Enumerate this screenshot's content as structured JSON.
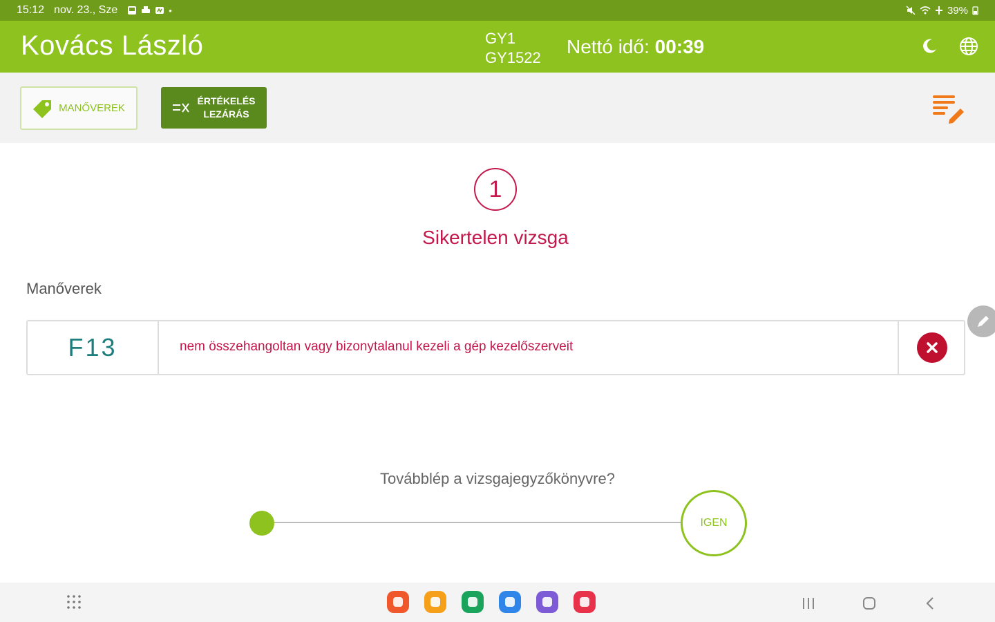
{
  "status_bar": {
    "time": "15:12",
    "date": "nov. 23., Sze",
    "battery": "39%"
  },
  "header": {
    "name": "Kovács László",
    "code1": "GY1",
    "code2": "GY1522",
    "netto_label": "Nettó idő:",
    "netto_value": "00:39"
  },
  "toolbar": {
    "manoverek_label": "MANŐVEREK",
    "lezaras_line1": "ÉRTÉKELÉS",
    "lezaras_line2": "LEZÁRÁS"
  },
  "result": {
    "count": "1",
    "title": "Sikertelen vizsga"
  },
  "maneuvers": {
    "section_label": "Manőverek",
    "items": [
      {
        "code": "F13",
        "description": "nem összehangoltan vagy bizonytalanul kezeli a gép kezelőszerveit"
      }
    ]
  },
  "proceed": {
    "question": "Továbblép a vizsgajegyzőkönyvre?",
    "confirm_label": "IGEN",
    "slider_progress": 0
  },
  "colors": {
    "status_bar": "#6f9c1b",
    "app_bar": "#8dc21f",
    "accent_dark": "#5a8a1e",
    "fail": "#c2184b",
    "code": "#1e7d7d",
    "edit_orange": "#f07a1a"
  },
  "dock_apps": [
    {
      "name": "notes-app-icon",
      "color": "#f0572a"
    },
    {
      "name": "folder-app-icon",
      "color": "#f6a01a"
    },
    {
      "name": "phone-app-icon",
      "color": "#1aa35b"
    },
    {
      "name": "messages-app-icon",
      "color": "#2f86e8"
    },
    {
      "name": "internet-app-icon",
      "color": "#7e5bd6"
    },
    {
      "name": "screen-recorder-app-icon",
      "color": "#e8324a"
    }
  ]
}
